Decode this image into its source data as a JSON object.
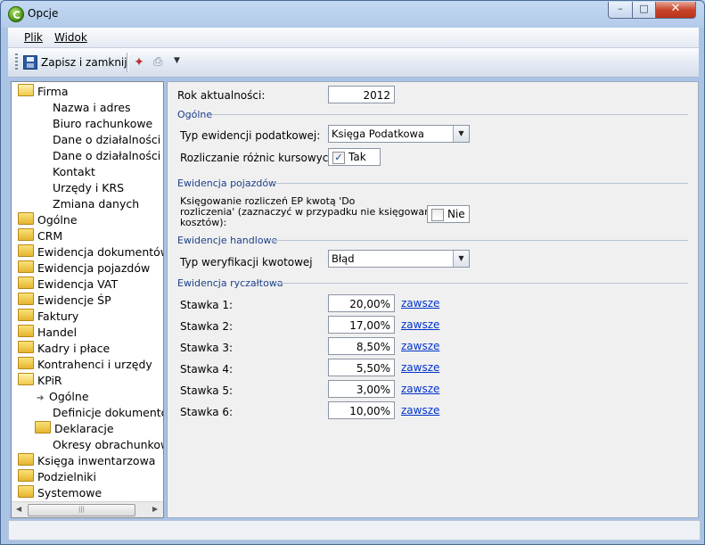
{
  "window": {
    "title": "Opcje",
    "ghost_text": "... ... ... ..."
  },
  "menu": {
    "plik": "Plik",
    "widok": "Widok"
  },
  "toolbar": {
    "save_label": "Zapisz i zamknij"
  },
  "tree": {
    "items": [
      {
        "label": "Firma",
        "kind": "folder-open",
        "indent": 0
      },
      {
        "label": "Nazwa i adres",
        "kind": "leaf",
        "indent": 1
      },
      {
        "label": "Biuro rachunkowe",
        "kind": "leaf",
        "indent": 1
      },
      {
        "label": "Dane o działalności",
        "kind": "leaf",
        "indent": 1
      },
      {
        "label": "Dane o działalności",
        "kind": "leaf",
        "indent": 1
      },
      {
        "label": "Kontakt",
        "kind": "leaf",
        "indent": 1
      },
      {
        "label": "Urzędy i KRS",
        "kind": "leaf",
        "indent": 1
      },
      {
        "label": "Zmiana danych",
        "kind": "leaf",
        "indent": 1
      },
      {
        "label": "Ogólne",
        "kind": "folder",
        "indent": 0
      },
      {
        "label": "CRM",
        "kind": "folder",
        "indent": 0
      },
      {
        "label": "Ewidencja dokumentów",
        "kind": "folder",
        "indent": 0
      },
      {
        "label": "Ewidencja pojazdów",
        "kind": "folder",
        "indent": 0
      },
      {
        "label": "Ewidencja VAT",
        "kind": "folder",
        "indent": 0
      },
      {
        "label": "Ewidencje ŚP",
        "kind": "folder",
        "indent": 0
      },
      {
        "label": "Faktury",
        "kind": "folder",
        "indent": 0
      },
      {
        "label": "Handel",
        "kind": "folder",
        "indent": 0
      },
      {
        "label": "Kadry i płace",
        "kind": "folder",
        "indent": 0
      },
      {
        "label": "Kontrahenci i urzędy",
        "kind": "folder",
        "indent": 0
      },
      {
        "label": "KPiR",
        "kind": "folder-open",
        "indent": 0
      },
      {
        "label": "Ogólne",
        "kind": "selected",
        "indent": 1
      },
      {
        "label": "Definicje dokumentów",
        "kind": "leaf",
        "indent": 1
      },
      {
        "label": "Deklaracje",
        "kind": "folder",
        "indent": 1
      },
      {
        "label": "Okresy obrachunkowe",
        "kind": "leaf",
        "indent": 1
      },
      {
        "label": "Księga inwentarzowa",
        "kind": "folder",
        "indent": 0
      },
      {
        "label": "Podzielniki",
        "kind": "folder",
        "indent": 0
      },
      {
        "label": "Systemowe",
        "kind": "folder",
        "indent": 0
      }
    ]
  },
  "form": {
    "rok_label": "Rok aktualności:",
    "rok_value": "2012",
    "ogolne_title": "Ogólne",
    "typ_ewidencji_label": "Typ ewidencji podatkowej:",
    "typ_ewidencji_value": "Księga Podatkowa",
    "rozliczanie_label": "Rozliczanie różnic kursowych:",
    "rozliczanie_checked": true,
    "rozliczanie_value": "Tak",
    "pojazdy_title": "Ewidencja pojazdów",
    "ksiegowanie_label_1": "Księgowanie rozliczeń EP kwotą 'Do",
    "ksiegowanie_label_2": "rozliczenia' (zaznaczyć w przypadku nie księgowania",
    "ksiegowanie_label_3": "kosztów):",
    "ksiegowanie_checked": false,
    "ksiegowanie_value": "Nie",
    "handlowe_title": "Ewidencje handlowe",
    "weryfikacja_label": "Typ weryfikacji kwotowej",
    "weryfikacja_value": "Błąd",
    "ryczalt_title": "Ewidencja ryczałtowa",
    "link_label": "zawsze",
    "stawki": [
      {
        "label": "Stawka 1:",
        "value": "20,00%"
      },
      {
        "label": "Stawka 2:",
        "value": "17,00%"
      },
      {
        "label": "Stawka 3:",
        "value": "8,50%"
      },
      {
        "label": "Stawka 4:",
        "value": "5,50%"
      },
      {
        "label": "Stawka 5:",
        "value": "3,00%"
      },
      {
        "label": "Stawka 6:",
        "value": "10,00%"
      }
    ]
  }
}
